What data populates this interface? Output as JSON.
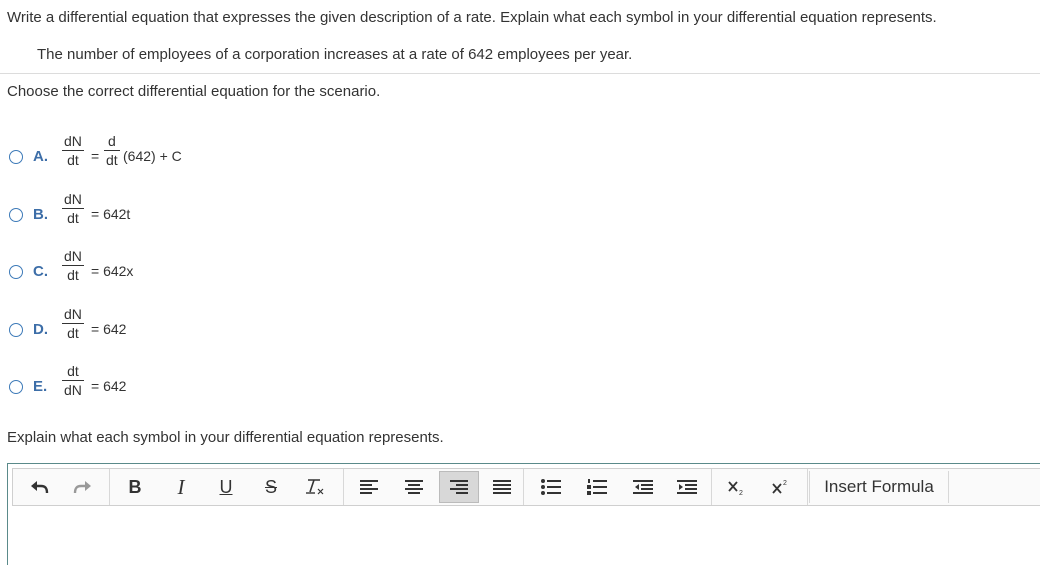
{
  "question": {
    "instruction": "Write a differential equation that expresses the given description of a rate. Explain what each symbol in your differential equation represents.",
    "scenario": "The number of employees of a corporation increases at a rate of 642 employees per year.",
    "prompt": "Choose the correct differential equation for the scenario."
  },
  "options": [
    {
      "letter": "A.",
      "num": "dN",
      "den": "dt",
      "eq": "=",
      "num2": "d",
      "den2": "dt",
      "rest": "(642) + C"
    },
    {
      "letter": "B.",
      "num": "dN",
      "den": "dt",
      "rest": "= 642t"
    },
    {
      "letter": "C.",
      "num": "dN",
      "den": "dt",
      "rest": "= 642x"
    },
    {
      "letter": "D.",
      "num": "dN",
      "den": "dt",
      "rest": "= 642"
    },
    {
      "letter": "E.",
      "num": "dt",
      "den": "dN",
      "rest": "= 642"
    }
  ],
  "explain_prompt": "Explain what each symbol in your differential equation represents.",
  "toolbar": {
    "bold": "B",
    "italic": "I",
    "underline": "U",
    "strike": "S",
    "insert_formula": "Insert Formula"
  },
  "colors": {
    "accent": "#3d6ea8",
    "radio_border": "#3d7ab8",
    "editor_border": "#5a8a8a"
  }
}
